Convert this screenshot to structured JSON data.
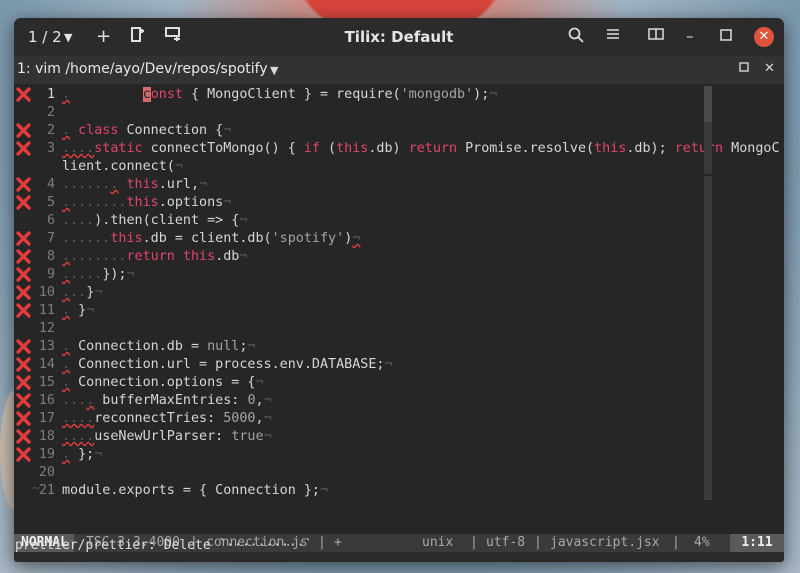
{
  "titlebar": {
    "session": "1 / 2",
    "title": "Tilix: Default"
  },
  "terminal": {
    "title": "1: vim /home/ayo/Dev/repos/spotify"
  },
  "editor": {
    "lines": [
      {
        "n": "1",
        "err": true,
        "current": true
      },
      {
        "n": "2",
        "err": false
      },
      {
        "n": "2",
        "err": true
      },
      {
        "n": "3",
        "err": true
      },
      {
        "n": "4",
        "err": true
      },
      {
        "n": "5",
        "err": true
      },
      {
        "n": "6",
        "err": false
      },
      {
        "n": "7",
        "err": true
      },
      {
        "n": "8",
        "err": true
      },
      {
        "n": "9",
        "err": true
      },
      {
        "n": "10",
        "err": true
      },
      {
        "n": "11",
        "err": true
      },
      {
        "n": "12",
        "err": false
      },
      {
        "n": "13",
        "err": true
      },
      {
        "n": "14",
        "err": true
      },
      {
        "n": "15",
        "err": true
      },
      {
        "n": "16",
        "err": true
      },
      {
        "n": "17",
        "err": true
      },
      {
        "n": "18",
        "err": true
      },
      {
        "n": "19",
        "err": true
      },
      {
        "n": "20",
        "err": false
      },
      {
        "n": "21",
        "err": false
      }
    ],
    "line_numbers": [
      "1",
      "2",
      "3",
      "",
      "4",
      "5",
      "6",
      "7",
      "8",
      "9",
      "10",
      "11",
      "12",
      "13",
      "14",
      "15",
      "16",
      "17",
      "18",
      "19",
      "",
      "21"
    ]
  },
  "status": {
    "mode": "NORMAL",
    "tsc": "TSC 3.3.4000",
    "file": "connection.js",
    "modified": "+",
    "fileformat": "unix",
    "encoding": "utf-8",
    "filetype": "javascript.jsx",
    "percent": "4%",
    "position": "1:11"
  },
  "message": "prettier/prettier: Delete `··········`",
  "colors": {
    "keyword": "#e0446a",
    "error_mark": "#e23b3b",
    "close_button": "#e0533d"
  }
}
